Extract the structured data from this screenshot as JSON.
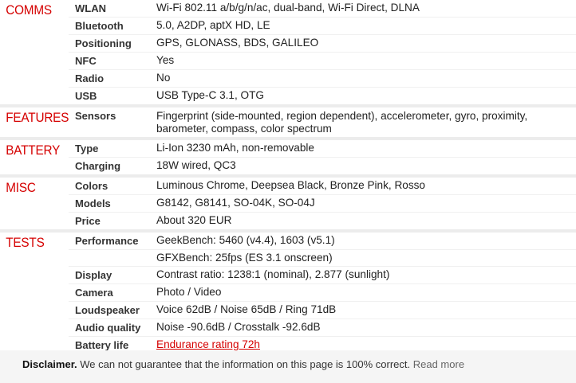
{
  "sections": {
    "comms": {
      "title": "COMMS",
      "rows": [
        {
          "label": "WLAN",
          "value": "Wi-Fi 802.11 a/b/g/n/ac, dual-band, Wi-Fi Direct, DLNA"
        },
        {
          "label": "Bluetooth",
          "value": "5.0, A2DP, aptX HD, LE"
        },
        {
          "label": "Positioning",
          "value": "GPS, GLONASS, BDS, GALILEO"
        },
        {
          "label": "NFC",
          "value": "Yes"
        },
        {
          "label": "Radio",
          "value": "No"
        },
        {
          "label": "USB",
          "value": "USB Type-C 3.1, OTG"
        }
      ]
    },
    "features": {
      "title": "FEATURES",
      "rows": [
        {
          "label": "Sensors",
          "value": "Fingerprint (side-mounted, region dependent), accelerometer, gyro, proximity, barometer, compass, color spectrum"
        }
      ]
    },
    "battery": {
      "title": "BATTERY",
      "rows": [
        {
          "label": "Type",
          "value": "Li-Ion 3230 mAh, non-removable"
        },
        {
          "label": "Charging",
          "value": "18W wired, QC3"
        }
      ]
    },
    "misc": {
      "title": "MISC",
      "rows": [
        {
          "label": "Colors",
          "value": "Luminous Chrome, Deepsea Black, Bronze Pink, Rosso"
        },
        {
          "label": "Models",
          "value": "G8142, G8141, SO-04K, SO-04J"
        },
        {
          "label": "Price",
          "value": "About 320 EUR"
        }
      ]
    },
    "tests": {
      "title": "TESTS",
      "rows": [
        {
          "label": "Performance",
          "value": "GeekBench: 5460 (v4.4), 1603 (v5.1)"
        },
        {
          "label": "",
          "value": "GFXBench: 25fps (ES 3.1 onscreen)"
        },
        {
          "label": "Display",
          "value": "Contrast ratio: 1238:1 (nominal), 2.877 (sunlight)"
        },
        {
          "label": "Camera",
          "value": "Photo / Video"
        },
        {
          "label": "Loudspeaker",
          "value": "Voice 62dB / Noise 65dB / Ring 71dB"
        },
        {
          "label": "Audio quality",
          "value": "Noise -90.6dB / Crosstalk -92.6dB"
        },
        {
          "label": "Battery life",
          "value": "Endurance rating 72h"
        }
      ]
    }
  },
  "disclaimer": {
    "bold": "Disclaimer.",
    "text": " We can not guarantee that the information on this page is 100% correct. ",
    "link": "Read more"
  },
  "colors": {
    "accent": "#d50000",
    "divider": "#ececec",
    "footer_bg": "#f5f5f5"
  }
}
